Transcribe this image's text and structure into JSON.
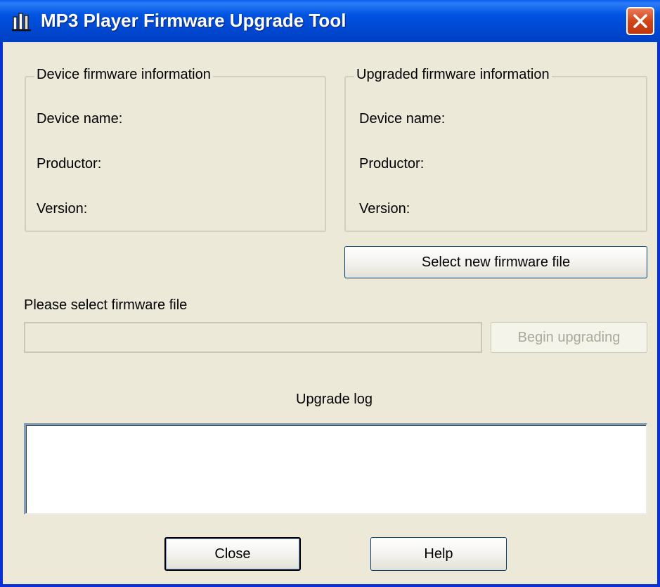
{
  "window": {
    "title": "MP3 Player Firmware Upgrade Tool",
    "app_icon": "player-app-icon",
    "close_icon": "close-icon",
    "colors": {
      "titlebar": "#0053E1",
      "close": "#D2451A",
      "face": "#ECE9D8"
    }
  },
  "device_info": {
    "group_label": "Device firmware information",
    "device_name_label": "Device name:",
    "productor_label": "Productor:",
    "version_label": "Version:"
  },
  "upgraded_info": {
    "group_label": "Upgraded firmware information",
    "device_name_label": "Device name:",
    "productor_label": "Productor:",
    "version_label": "Version:"
  },
  "buttons": {
    "select_file": "Select new firmware file",
    "begin_upgrading": "Begin upgrading",
    "close": "Close",
    "help": "Help"
  },
  "file_prompt": "Please select firmware file",
  "file_path": {
    "value": ""
  },
  "upgrade_log_label": "Upgrade log",
  "upgrade_log": {
    "value": ""
  }
}
